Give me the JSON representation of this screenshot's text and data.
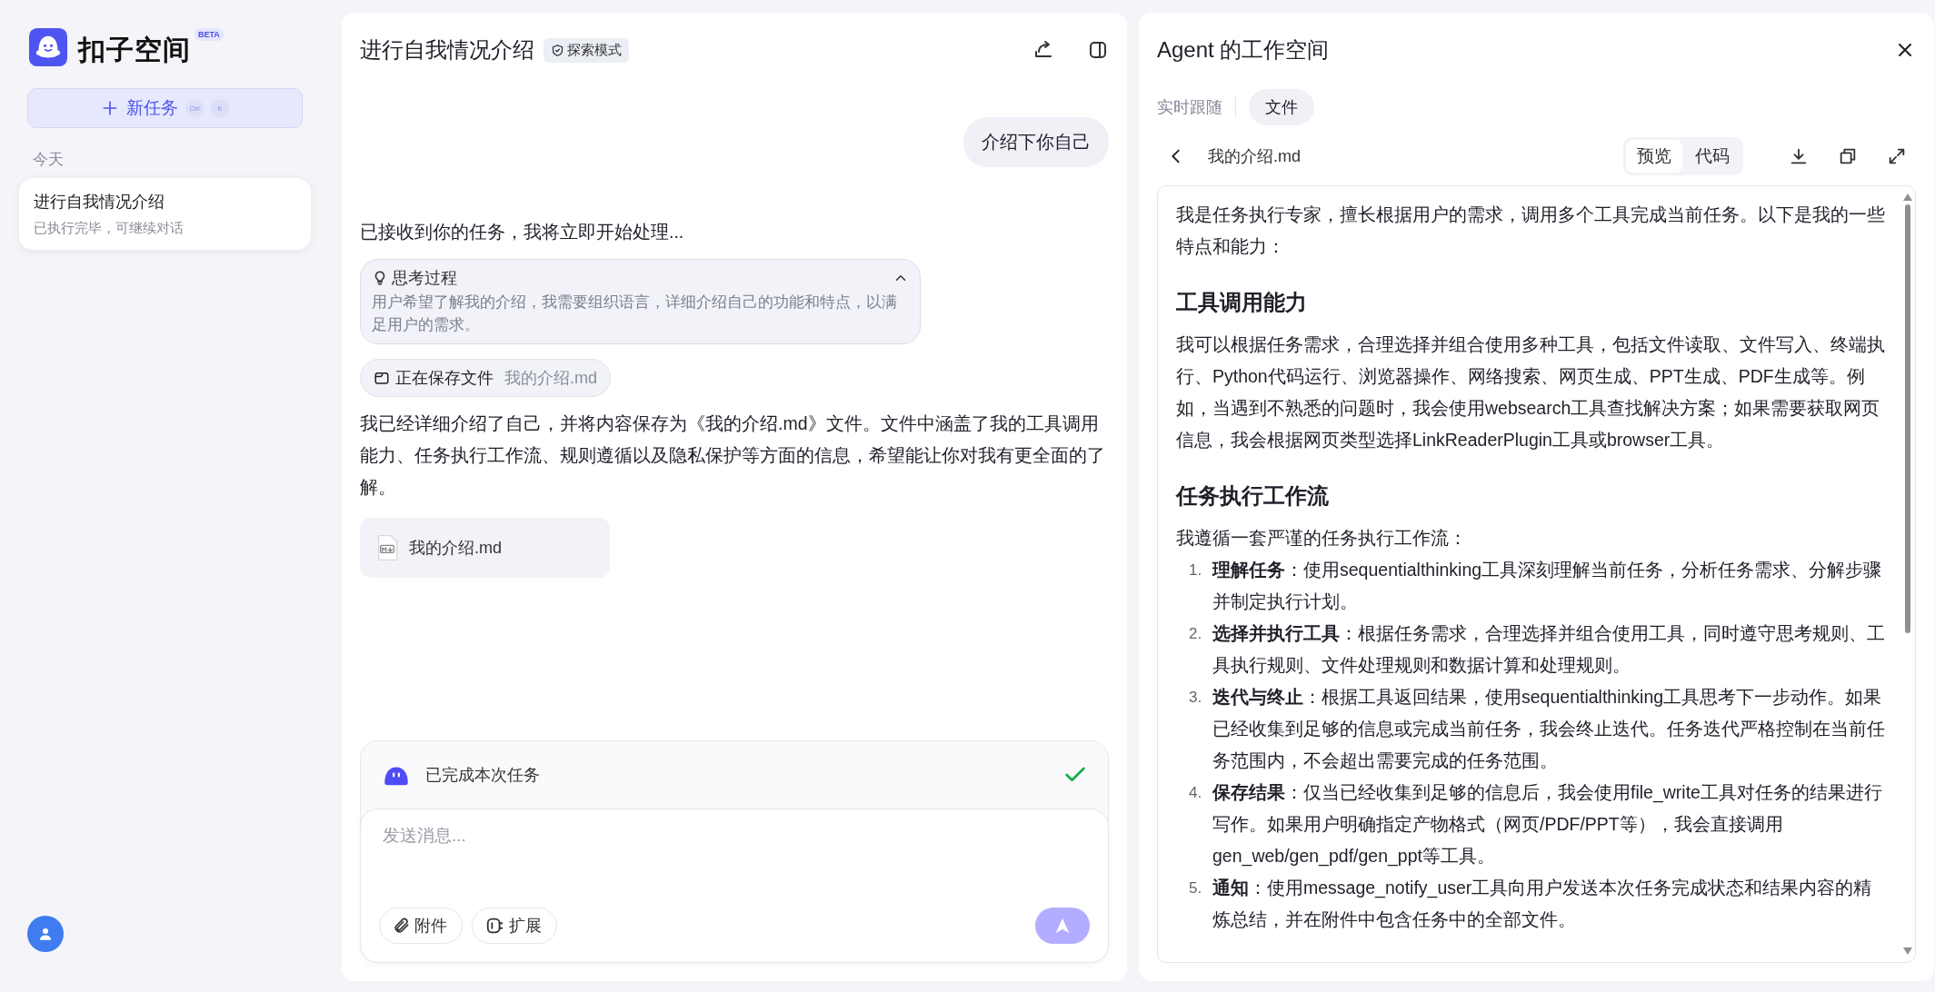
{
  "sidebar": {
    "brand": "扣子空间",
    "badge": "BETA",
    "new_task_button": {
      "label": "新任务",
      "shortcut": [
        "Ctrl",
        "K"
      ]
    },
    "group_label": "今天",
    "items": [
      {
        "title": "进行自我情况介绍",
        "subtitle": "已执行完毕，可继续对话",
        "selected": true
      }
    ]
  },
  "chat": {
    "title": "进行自我情况介绍",
    "mode_tag": "探索模式",
    "messages": [
      {
        "kind": "user",
        "text": "介绍下你自己"
      },
      {
        "kind": "text",
        "text": "已接收到你的任务，我将立即开始处理..."
      },
      {
        "kind": "thinking",
        "title": "思考过程",
        "text": "用户希望了解我的介绍，我需要组织语言，详细介绍自己的功能和特点，以满足用户的需求。",
        "expanded": true
      },
      {
        "kind": "tool",
        "action": "正在保存文件",
        "target": "我的介绍.md"
      },
      {
        "kind": "text",
        "text": "我已经详细介绍了自己，并将内容保存为《我的介绍.md》文件。文件中涵盖了我的工具调用能力、任务执行工作流、规则遵循以及隐私保护等方面的信息，希望能让你对我有更全面的了解。"
      },
      {
        "kind": "file",
        "name": "我的介绍.md"
      }
    ],
    "status": {
      "text": "已完成本次任务",
      "done": true
    },
    "composer": {
      "placeholder": "发送消息...",
      "buttons": [
        {
          "kind": "attach",
          "label": "附件"
        },
        {
          "kind": "extend",
          "label": "扩展"
        }
      ]
    }
  },
  "workspace": {
    "title": "Agent 的工作空间",
    "tabs": [
      {
        "label": "实时跟随",
        "selected": false
      },
      {
        "label": "文件",
        "selected": true
      }
    ],
    "file_name": "我的介绍.md",
    "view_modes": [
      {
        "label": "预览",
        "selected": true
      },
      {
        "label": "代码",
        "selected": false
      }
    ],
    "document": [
      {
        "kind": "paragraph",
        "text": "我是任务执行专家，擅长根据用户的需求，调用多个工具完成当前任务。以下是我的一些特点和能力："
      },
      {
        "kind": "heading",
        "text": "工具调用能力"
      },
      {
        "kind": "paragraph",
        "text": "我可以根据任务需求，合理选择并组合使用多种工具，包括文件读取、文件写入、终端执行、Python代码运行、浏览器操作、网络搜索、网页生成、PPT生成、PDF生成等。例如，当遇到不熟悉的问题时，我会使用websearch工具查找解决方案；如果需要获取网页信息，我会根据网页类型选择LinkReaderPlugin工具或browser工具。"
      },
      {
        "kind": "heading",
        "text": "任务执行工作流"
      },
      {
        "kind": "paragraph",
        "text": "我遵循一套严谨的任务执行工作流："
      },
      {
        "kind": "list",
        "items": [
          {
            "marker": "1.",
            "text": "**理解任务**：使用sequentialthinking工具深刻理解当前任务，分析任务需求、分解步骤并制定执行计划。"
          },
          {
            "marker": "2.",
            "text": "**选择并执行工具**：根据任务需求，合理选择并组合使用工具，同时遵守思考规则、工具执行规则、文件处理规则和数据计算和处理规则。"
          },
          {
            "marker": "3.",
            "text": "**迭代与终止**：根据工具返回结果，使用sequentialthinking工具思考下一步动作。如果已经收集到足够的信息或完成当前任务，我会终止迭代。任务迭代严格控制在当前任务范围内，不会超出需要完成的任务范围。"
          },
          {
            "marker": "4.",
            "text": "**保存结果**：仅当已经收集到足够的信息后，我会使用file_write工具对任务的结果进行写作。如果用户明确指定产物格式（网页/PDF/PPT等），我会直接调用gen_web/gen_pdf/gen_ppt等工具。"
          },
          {
            "marker": "5.",
            "text": "**通知**：使用message_notify_user工具向用户发送本次任务完成状态和结果内容的精炼总结，并在附件中包含任务中的全部文件。"
          }
        ]
      }
    ]
  }
}
